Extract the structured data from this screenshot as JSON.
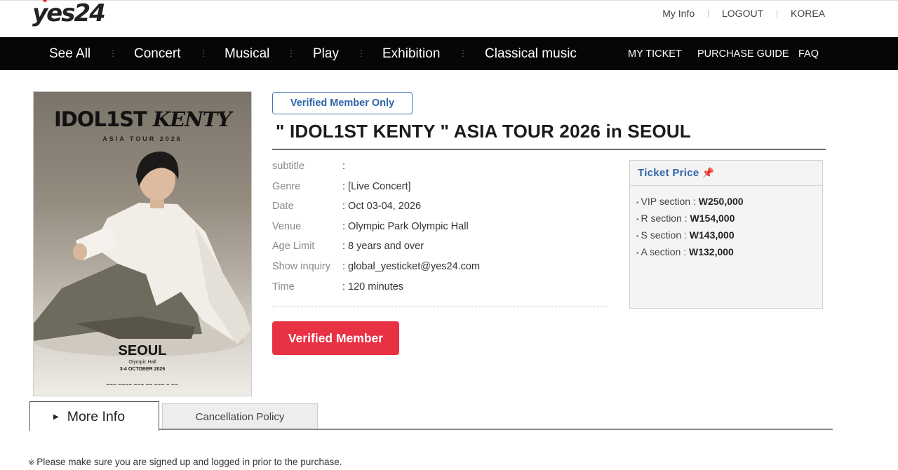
{
  "header": {
    "logo_text": "yes24",
    "links": [
      "My Info",
      "LOGOUT",
      "KOREA"
    ]
  },
  "nav": {
    "categories": [
      "See All",
      "Concert",
      "Musical",
      "Play",
      "Exhibition",
      "Classical music"
    ],
    "right_links": [
      "MY TICKET",
      "PURCHASE GUIDE",
      "FAQ"
    ]
  },
  "poster": {
    "title_part1": "IDOL1ST",
    "title_part2": "KENTY",
    "subtitle": "ASIA TOUR 2026",
    "city": "SEOUL",
    "venue": "Olympic Hall",
    "dates": "3-4 OCTOBER 2026"
  },
  "event": {
    "badge": "Verified Member Only",
    "title": "\" IDOL1ST KENTY \"  ASIA TOUR 2026 in SEOUL",
    "info": [
      {
        "label": "subtitle",
        "value": ":"
      },
      {
        "label": "Genre",
        "value": ": [Live Concert]"
      },
      {
        "label": "Date",
        "value": ": Oct 03-04, 2026"
      },
      {
        "label": "Venue",
        "value": ": Olympic Park Olympic Hall"
      },
      {
        "label": "Age Limit",
        "value": ": 8 years and over"
      },
      {
        "label": "Show inquiry",
        "value": ": global_yesticket@yes24.com"
      },
      {
        "label": "Time",
        "value": ": 120 minutes"
      }
    ],
    "verify_button": "Verified Member"
  },
  "ticket_price": {
    "heading": "Ticket Price",
    "icon": "pin-icon",
    "rows": [
      {
        "section": "VIP section : ",
        "price": "W250,000"
      },
      {
        "section": "R section : ",
        "price": "W154,000"
      },
      {
        "section": "S section : ",
        "price": "W143,000"
      },
      {
        "section": "A section : ",
        "price": "W132,000"
      }
    ]
  },
  "tabs": {
    "active": "More Info",
    "inactive": "Cancellation Policy"
  },
  "notice": "Please make sure you are signed up and logged in prior to the purchase.",
  "colors": {
    "accent_red": "#e83143",
    "accent_blue": "#2f64a8",
    "nav_bg": "#060606"
  }
}
